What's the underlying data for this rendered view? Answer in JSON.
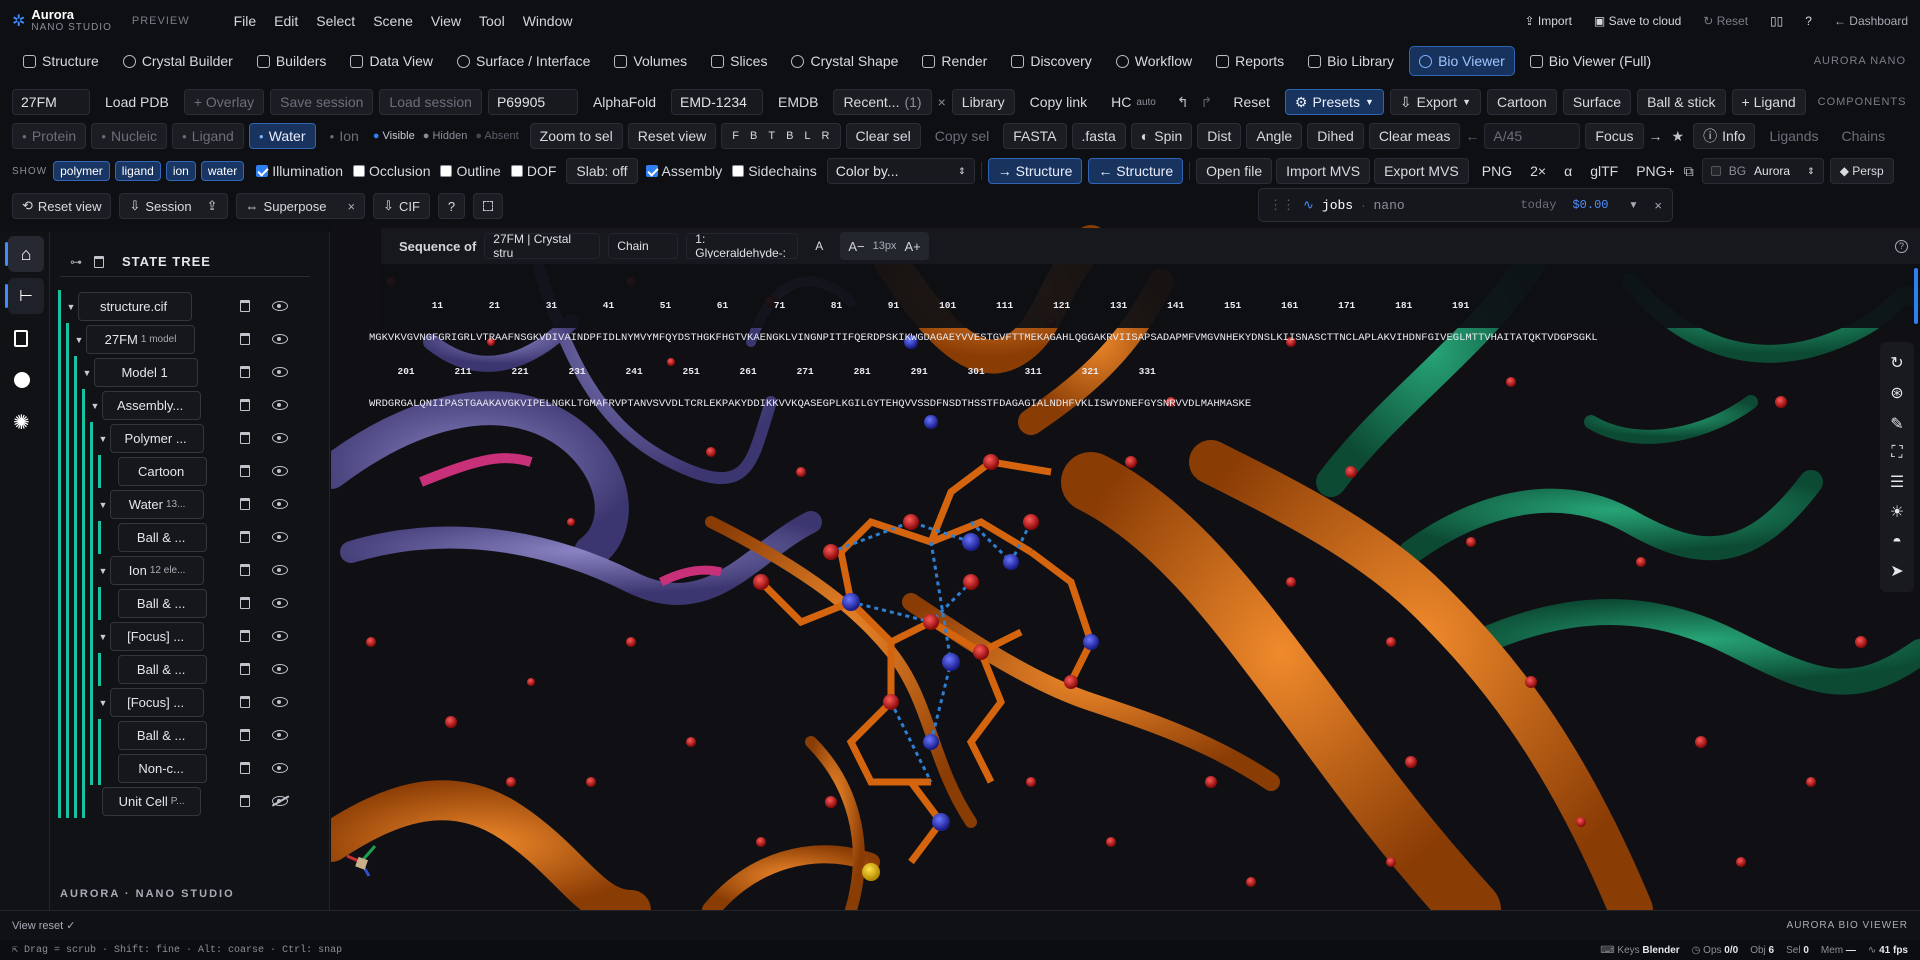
{
  "app": {
    "name": "Aurora",
    "sub": "NANO STUDIO",
    "badge": "PREVIEW"
  },
  "menu": [
    "File",
    "Edit",
    "Select",
    "Scene",
    "View",
    "Tool",
    "Window"
  ],
  "topright": {
    "import": "Import",
    "save": "Save to cloud",
    "reset": "Reset",
    "help": "?",
    "dashboard": "← Dashboard"
  },
  "tabs": [
    {
      "label": "Structure",
      "icon": "structure-icon"
    },
    {
      "label": "Crystal Builder",
      "icon": "crystal-icon"
    },
    {
      "label": "Builders",
      "icon": "builders-icon"
    },
    {
      "label": "Data View",
      "icon": "database-icon"
    },
    {
      "label": "Surface / Interface",
      "icon": "layers-icon"
    },
    {
      "label": "Volumes",
      "icon": "volumes-icon"
    },
    {
      "label": "Slices",
      "icon": "slices-icon"
    },
    {
      "label": "Crystal Shape",
      "icon": "gem-icon"
    },
    {
      "label": "Render",
      "icon": "camera-icon"
    },
    {
      "label": "Discovery",
      "icon": "discovery-icon"
    },
    {
      "label": "Workflow",
      "icon": "workflow-icon"
    },
    {
      "label": "Reports",
      "icon": "reports-icon"
    },
    {
      "label": "Bio Library",
      "icon": "library-icon"
    },
    {
      "label": "Bio Viewer",
      "icon": "bio-viewer-icon"
    },
    {
      "label": "Bio Viewer (Full)",
      "icon": "bio-viewer-full-icon"
    }
  ],
  "brand_right": "AURORA NANO",
  "toolbar1": {
    "pdb_value": "27FM",
    "load_pdb": "Load PDB",
    "overlay": "+ Overlay",
    "save_session": "Save session",
    "load_session": "Load session",
    "uniprot_value": "P69905",
    "alphafold": "AlphaFold",
    "emdb_value": "EMD-1234",
    "emdb": "EMDB",
    "recent": "Recent...",
    "recent_count": "(1)",
    "close": "×",
    "library": "Library",
    "copy_link": "Copy link",
    "hc": "HC",
    "hc_sub": "auto",
    "reset": "Reset",
    "presets": "Presets",
    "export": "Export",
    "cartoon": "Cartoon",
    "surface": "Surface",
    "ballstick": "Ball & stick",
    "ligand": "+ Ligand",
    "components": "COMPONENTS"
  },
  "toolbar2": {
    "protein": "Protein",
    "nucleic": "Nucleic",
    "ligand": "Ligand",
    "water": "Water",
    "ion": "Ion",
    "visible": "Visible",
    "hidden": "Hidden",
    "absent": "Absent",
    "zoom_sel": "Zoom to sel",
    "reset_view": "Reset view",
    "views": [
      "F",
      "B",
      "T",
      "B",
      "L",
      "R"
    ],
    "clear_sel": "Clear sel",
    "copy_sel": "Copy sel",
    "fasta": "FASTA",
    "fasta_file": ".fasta",
    "spin": "Spin",
    "dist": "Dist",
    "angle": "Angle",
    "dihed": "Dihed",
    "clear_meas": "Clear meas",
    "query_placeholder": "A/45",
    "focus": "Focus",
    "info": "Info",
    "ligands": "Ligands",
    "chains": "Chains"
  },
  "toolbar3": {
    "show": "SHOW",
    "tags": [
      "polymer",
      "ligand",
      "ion",
      "water"
    ],
    "checks": [
      {
        "label": "Illumination",
        "on": true
      },
      {
        "label": "Occlusion",
        "on": false
      },
      {
        "label": "Outline",
        "on": false
      },
      {
        "label": "DOF",
        "on": false
      }
    ],
    "slab": "Slab: off",
    "checks2": [
      {
        "label": "Assembly",
        "on": true
      },
      {
        "label": "Sidechains",
        "on": false
      }
    ],
    "color_by": "Color by...",
    "to_structure": "→ Structure",
    "from_structure": "← Structure",
    "open_file": "Open file",
    "import_mvs": "Import MVS",
    "export_mvs": "Export MVS",
    "png": "PNG",
    "scale": "2×",
    "alpha": "α",
    "gltf": "glTF",
    "pngplus": "PNG+",
    "bg": "BG",
    "bg_value": "Aurora",
    "persp": "◆ Persp"
  },
  "toolbar4": {
    "reset_view": "Reset view",
    "session": "Session",
    "superpose": "Superpose",
    "close": "×",
    "cif": "CIF",
    "help": "?"
  },
  "jobs": {
    "title": "jobs",
    "sub": "nano",
    "time": "today",
    "cost": "$0.00"
  },
  "panel": {
    "title": "STATE TREE",
    "footer": "AURORA · NANO STUDIO"
  },
  "tree": [
    {
      "label": "structure.cif",
      "sub": "",
      "hidden": false
    },
    {
      "label": "27FM",
      "sub": "1 model",
      "hidden": false
    },
    {
      "label": "Model 1",
      "sub": "",
      "hidden": false
    },
    {
      "label": "Assembly...",
      "sub": "",
      "hidden": false
    },
    {
      "label": "Polymer ...",
      "sub": "",
      "hidden": false
    },
    {
      "label": "Cartoon",
      "sub": "",
      "hidden": false
    },
    {
      "label": "Water",
      "sub": "13...",
      "hidden": false
    },
    {
      "label": "Ball & ...",
      "sub": "",
      "hidden": false
    },
    {
      "label": "Ion",
      "sub": "12 ele...",
      "hidden": false
    },
    {
      "label": "Ball & ...",
      "sub": "",
      "hidden": false
    },
    {
      "label": "[Focus] ...",
      "sub": "",
      "hidden": false
    },
    {
      "label": "Ball & ...",
      "sub": "",
      "hidden": false
    },
    {
      "label": "[Focus] ...",
      "sub": "",
      "hidden": false
    },
    {
      "label": "Ball & ...",
      "sub": "",
      "hidden": false
    },
    {
      "label": "Non-c...",
      "sub": "",
      "hidden": false
    },
    {
      "label": "Unit Cell",
      "sub": "P...",
      "hidden": true
    }
  ],
  "sequence": {
    "label": "Sequence of",
    "entity": "27FM | Crystal stru",
    "chain": "Chain",
    "entity_select": "1: Glyceraldehyde-:",
    "font_a": "A",
    "font_minus": "A−",
    "font_size": "13px",
    "font_plus": "A+",
    "ruler1": "           11        21        31        41        51        61        71        81        91       101       111       121       131       141       151       161       171       181       191",
    "seq1": "MGKVKVGVNGFGRIGRLVTRAAFNSGKVDIVAINDPFIDLNYMVYMFQYDSTHGKFHGTVKAENGKLVINGNPITIFQERDPSKIKWGDAGAEYVVESTGVFTTMEKAGAHLQGGAKRVIISAPSADAPMFVMGVNHEKYDNSLKIISNASCTTNCLAPLAKVIHDNFGIVEGLMTTVHAITATQKTVDGPSGKL",
    "ruler2": "     201       211       221       231       241       251       261       271       281       291       301       311       321       331",
    "seq2": "WRDGRGALQNIIPASTGAAKAVGKVIPELNGKLTGMAFRVPTANVSVVDLTCRLEKPAKYDDIKKVVKQASEGPLKGILGYTEHQVVSSDFNSDTHSSTFDAGAGIALNDHFVKLISWYDNEFGYSNRVVDLMAHMASKE"
  },
  "status": {
    "left": "View reset ✓",
    "right": "AURORA BIO VIEWER"
  },
  "hints": "⇱ Drag = scrub · Shift: fine · Alt: coarse · Ctrl: snap",
  "footer_right": {
    "keys": "Keys",
    "keys_value": "Blender",
    "ops": "Ops",
    "ops_value": "0/0",
    "obj": "Obj",
    "obj_value": "6",
    "sel": "Sel",
    "sel_value": "0",
    "mem": "Mem",
    "mem_value": "—",
    "fps": "41 fps"
  },
  "colors": {
    "accent": "#2f7ff0",
    "teal": "#18c2a0",
    "orange": "#d4650e",
    "purple": "#6a62a8",
    "green": "#1a8a63",
    "pink": "#c8307a"
  }
}
